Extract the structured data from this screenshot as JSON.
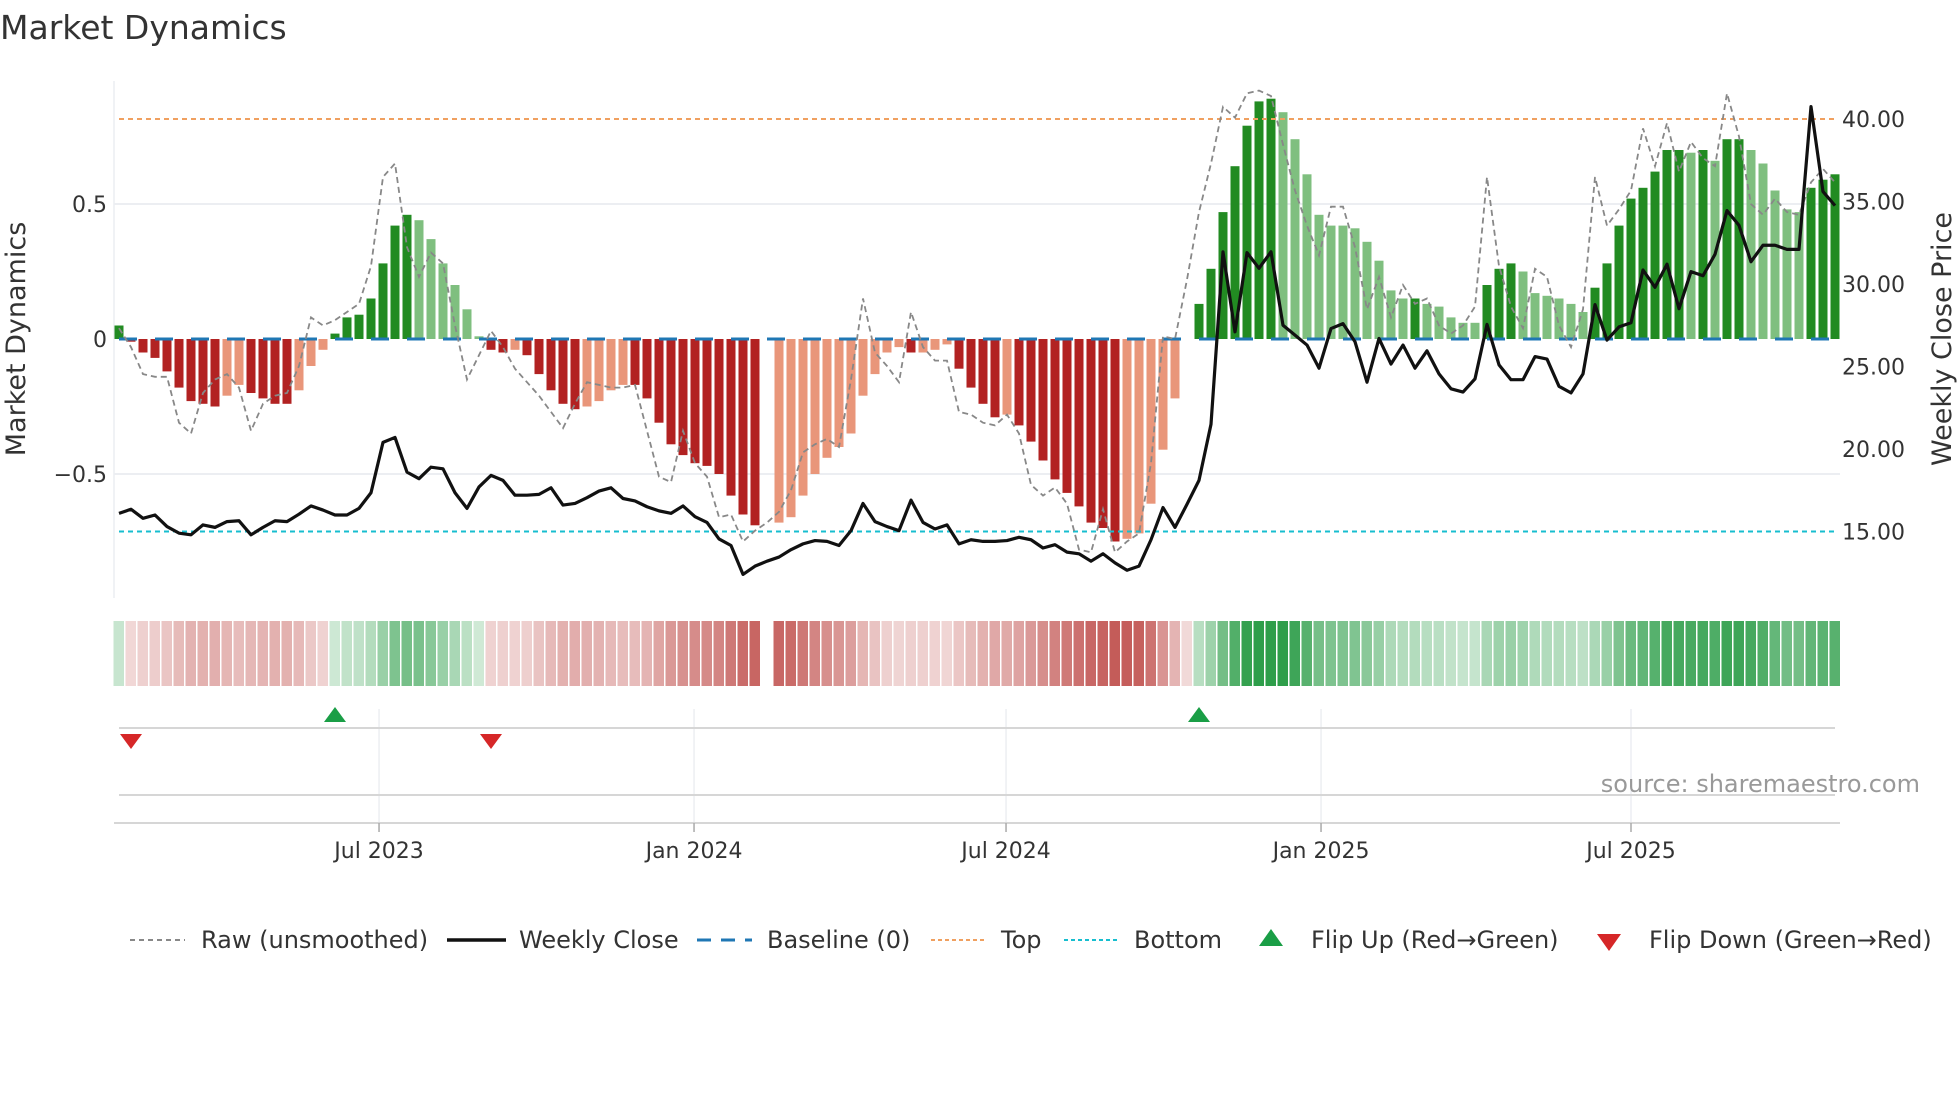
{
  "title": "Market Dynamics",
  "source": "source: sharemaestro.com",
  "chart_data": {
    "type": "bar",
    "title": "Market Dynamics",
    "ylabel": "Market Dynamics",
    "y2label": "Weekly Close Price",
    "ylim": [
      -0.97,
      0.97
    ],
    "y2lim": [
      11.6,
      42.6
    ],
    "yticks": [
      {
        "v": 0.5,
        "label": "0.5"
      },
      {
        "v": 0,
        "label": "0"
      },
      {
        "v": -0.5,
        "label": "−0.5"
      }
    ],
    "y2ticks": [
      {
        "v": 40,
        "label": "40.00"
      },
      {
        "v": 35,
        "label": "35.00"
      },
      {
        "v": 30,
        "label": "30.00"
      },
      {
        "v": 25,
        "label": "25.00"
      },
      {
        "v": 20,
        "label": "20.00"
      },
      {
        "v": 15,
        "label": "15.00"
      }
    ],
    "xticks": [
      {
        "week": 21.67,
        "label": "Jul 2023"
      },
      {
        "week": 47.92,
        "label": "Jan 2024"
      },
      {
        "week": 73.92,
        "label": "Jul 2024"
      },
      {
        "week": 100.17,
        "label": "Jan 2025"
      },
      {
        "week": 126.0,
        "label": "Jul 2025"
      }
    ],
    "top_level": 0.815,
    "bottom_level": -0.713,
    "baseline": 0,
    "bar_values": [
      0.05,
      -0.01,
      -0.05,
      -0.07,
      -0.12,
      -0.18,
      -0.23,
      -0.24,
      -0.25,
      -0.21,
      -0.17,
      -0.2,
      -0.22,
      -0.24,
      -0.24,
      -0.19,
      -0.1,
      -0.04,
      0.02,
      0.08,
      0.09,
      0.15,
      0.28,
      0.42,
      0.46,
      0.44,
      0.37,
      0.28,
      0.2,
      0.11,
      0.01,
      -0.04,
      -0.05,
      -0.04,
      -0.06,
      -0.13,
      -0.19,
      -0.24,
      -0.26,
      -0.25,
      -0.23,
      -0.19,
      -0.17,
      -0.17,
      -0.22,
      -0.31,
      -0.39,
      -0.43,
      -0.46,
      -0.47,
      -0.5,
      -0.58,
      -0.65,
      -0.69,
      null,
      -0.68,
      -0.66,
      -0.58,
      -0.5,
      -0.44,
      -0.4,
      -0.35,
      -0.21,
      -0.13,
      -0.05,
      -0.03,
      -0.05,
      -0.05,
      -0.04,
      -0.02,
      -0.11,
      -0.18,
      -0.24,
      -0.29,
      -0.28,
      -0.32,
      -0.38,
      -0.45,
      -0.52,
      -0.57,
      -0.62,
      -0.68,
      -0.7,
      -0.75,
      -0.74,
      -0.72,
      -0.61,
      -0.41,
      -0.22,
      0,
      0.13,
      0.26,
      0.47,
      0.64,
      0.79,
      0.88,
      0.89,
      0.84,
      0.74,
      0.61,
      0.46,
      0.42,
      0.42,
      0.41,
      0.36,
      0.29,
      0.18,
      0.15,
      0.15,
      0.13,
      0.12,
      0.08,
      0.06,
      0.06,
      0.2,
      0.26,
      0.28,
      0.25,
      0.17,
      0.16,
      0.15,
      0.13,
      0.1,
      0.19,
      0.28,
      0.42,
      0.52,
      0.56,
      0.62,
      0.7,
      0.7,
      0.69,
      0.7,
      0.66,
      0.74,
      0.74,
      0.7,
      0.65,
      0.55,
      0.48,
      0.47,
      0.56,
      0.59,
      0.61
    ],
    "bar_states": [
      "dg",
      "dr",
      "dr",
      "dr",
      "dr",
      "dr",
      "dr",
      "dr",
      "dr",
      "lr",
      "lr",
      "dr",
      "dr",
      "dr",
      "dr",
      "lr",
      "lr",
      "lr",
      "dg",
      "dg",
      "dg",
      "dg",
      "dg",
      "dg",
      "dg",
      "lg",
      "lg",
      "lg",
      "lg",
      "lg",
      "lg",
      "dr",
      "dr",
      "lr",
      "dr",
      "dr",
      "dr",
      "dr",
      "dr",
      "lr",
      "lr",
      "lr",
      "lr",
      "dr",
      "dr",
      "dr",
      "dr",
      "dr",
      "dr",
      "dr",
      "dr",
      "dr",
      "dr",
      "dr",
      "none",
      "lr",
      "lr",
      "lr",
      "lr",
      "lr",
      "lr",
      "lr",
      "lr",
      "lr",
      "lr",
      "lr",
      "dr",
      "lr",
      "lr",
      "lr",
      "dr",
      "dr",
      "dr",
      "dr",
      "lr",
      "dr",
      "dr",
      "dr",
      "dr",
      "dr",
      "dr",
      "dr",
      "dr",
      "dr",
      "lr",
      "lr",
      "lr",
      "lr",
      "lr",
      "none",
      "dg",
      "dg",
      "dg",
      "dg",
      "dg",
      "dg",
      "dg",
      "lg",
      "lg",
      "lg",
      "lg",
      "lg",
      "lg",
      "lg",
      "lg",
      "lg",
      "lg",
      "lg",
      "dg",
      "lg",
      "lg",
      "lg",
      "lg",
      "lg",
      "dg",
      "dg",
      "dg",
      "lg",
      "lg",
      "lg",
      "lg",
      "lg",
      "lg",
      "dg",
      "dg",
      "dg",
      "dg",
      "dg",
      "dg",
      "dg",
      "dg",
      "lg",
      "dg",
      "lg",
      "dg",
      "dg",
      "lg",
      "lg",
      "lg",
      "lg",
      "lg",
      "dg",
      "dg",
      "dg"
    ],
    "raw_values": [
      0.04,
      -0.03,
      -0.13,
      -0.14,
      -0.14,
      -0.31,
      -0.35,
      -0.2,
      -0.15,
      -0.13,
      -0.18,
      -0.34,
      -0.24,
      -0.21,
      -0.2,
      -0.1,
      0.08,
      0.05,
      0.07,
      0.1,
      0.13,
      0.27,
      0.6,
      0.65,
      0.34,
      0.23,
      0.32,
      0.28,
      0.05,
      -0.15,
      -0.06,
      0.03,
      -0.03,
      -0.11,
      -0.16,
      -0.21,
      -0.27,
      -0.33,
      -0.24,
      -0.16,
      -0.17,
      -0.18,
      -0.18,
      -0.17,
      -0.34,
      -0.51,
      -0.53,
      -0.34,
      -0.46,
      -0.51,
      -0.66,
      -0.65,
      -0.75,
      -0.71,
      -0.68,
      -0.64,
      -0.56,
      -0.42,
      -0.39,
      -0.37,
      -0.4,
      -0.15,
      0.15,
      -0.05,
      -0.1,
      -0.16,
      0.1,
      -0.03,
      -0.08,
      -0.08,
      -0.27,
      -0.28,
      -0.31,
      -0.32,
      -0.28,
      -0.35,
      -0.54,
      -0.58,
      -0.55,
      -0.61,
      -0.78,
      -0.79,
      -0.63,
      -0.79,
      -0.75,
      -0.72,
      -0.46,
      0.01,
      0.0,
      0.22,
      0.47,
      0.65,
      0.86,
      0.82,
      0.91,
      0.92,
      0.9,
      0.72,
      0.55,
      0.42,
      0.31,
      0.49,
      0.49,
      0.34,
      0.11,
      0.23,
      0.08,
      0.2,
      0.13,
      0.15,
      0.05,
      0.02,
      0.05,
      0.12,
      0.6,
      0.27,
      0.12,
      0.04,
      0.26,
      0.23,
      0.05,
      -0.03,
      0.11,
      0.6,
      0.42,
      0.48,
      0.55,
      0.78,
      0.64,
      0.8,
      0.62,
      0.73,
      0.67,
      0.64,
      0.91,
      0.75,
      0.5,
      0.46,
      0.52,
      0.47,
      0.46,
      0.58,
      0.63,
      0.58
    ],
    "weekly_close": [
      16.1,
      16.35,
      15.8,
      16.0,
      15.3,
      14.9,
      14.8,
      15.4,
      15.25,
      15.6,
      15.65,
      14.8,
      15.25,
      15.65,
      15.6,
      16.05,
      16.55,
      16.3,
      16.0,
      16.0,
      16.4,
      17.35,
      20.4,
      20.7,
      18.6,
      18.2,
      18.9,
      18.8,
      17.35,
      16.4,
      17.7,
      18.4,
      18.1,
      17.2,
      17.2,
      17.25,
      17.65,
      16.6,
      16.7,
      17.05,
      17.45,
      17.65,
      17.0,
      16.85,
      16.5,
      16.25,
      16.1,
      16.55,
      15.9,
      15.55,
      14.55,
      14.15,
      12.4,
      12.9,
      13.2,
      13.45,
      13.9,
      14.25,
      14.45,
      14.4,
      14.15,
      15.05,
      16.7,
      15.6,
      15.3,
      15.05,
      16.9,
      15.55,
      15.15,
      15.4,
      14.25,
      14.5,
      14.4,
      14.4,
      14.45,
      14.65,
      14.5,
      14.0,
      14.2,
      13.75,
      13.65,
      13.2,
      13.65,
      13.1,
      12.65,
      12.9,
      14.5,
      16.45,
      15.25,
      16.65,
      18.1,
      21.5,
      31.95,
      27.1,
      31.9,
      30.95,
      31.95,
      27.5,
      26.9,
      26.3,
      24.9,
      27.3,
      27.6,
      26.5,
      24.05,
      26.7,
      25.15,
      26.3,
      24.9,
      25.95,
      24.55,
      23.65,
      23.45,
      24.25,
      27.55,
      25.1,
      24.2,
      24.2,
      25.6,
      25.45,
      23.8,
      23.4,
      24.55,
      28.75,
      26.6,
      27.4,
      27.65,
      30.85,
      29.8,
      31.2,
      28.5,
      30.75,
      30.5,
      31.8,
      34.45,
      33.55,
      31.35,
      32.35,
      32.35,
      32.1,
      32.1,
      40.75,
      35.6,
      34.75
    ],
    "flips": [
      {
        "week": 1,
        "type": "down"
      },
      {
        "week": 18,
        "type": "up"
      },
      {
        "week": 31,
        "type": "down"
      },
      {
        "week": 90,
        "type": "up"
      }
    ],
    "legend_position": "bottom",
    "colors": {
      "dg": "#228b22",
      "lg": "#7fbf7f",
      "dr": "#b22222",
      "lr": "#e9967a",
      "raw": "#888888",
      "close": "#111111",
      "baseline": "#1f77b4",
      "top": "#f0a060",
      "bottom": "#17becf",
      "flip_up": "#1a9e46",
      "flip_down": "#d62728",
      "heat_green": "#2e9e4a",
      "heat_red": "#c0504d"
    }
  },
  "legend": [
    {
      "label": "Raw (unsmoothed)"
    },
    {
      "label": "Weekly Close"
    },
    {
      "label": "Baseline (0)"
    },
    {
      "label": "Top"
    },
    {
      "label": "Bottom"
    },
    {
      "label": "Flip Up (Red→Green)"
    },
    {
      "label": "Flip Down (Green→Red)"
    }
  ]
}
